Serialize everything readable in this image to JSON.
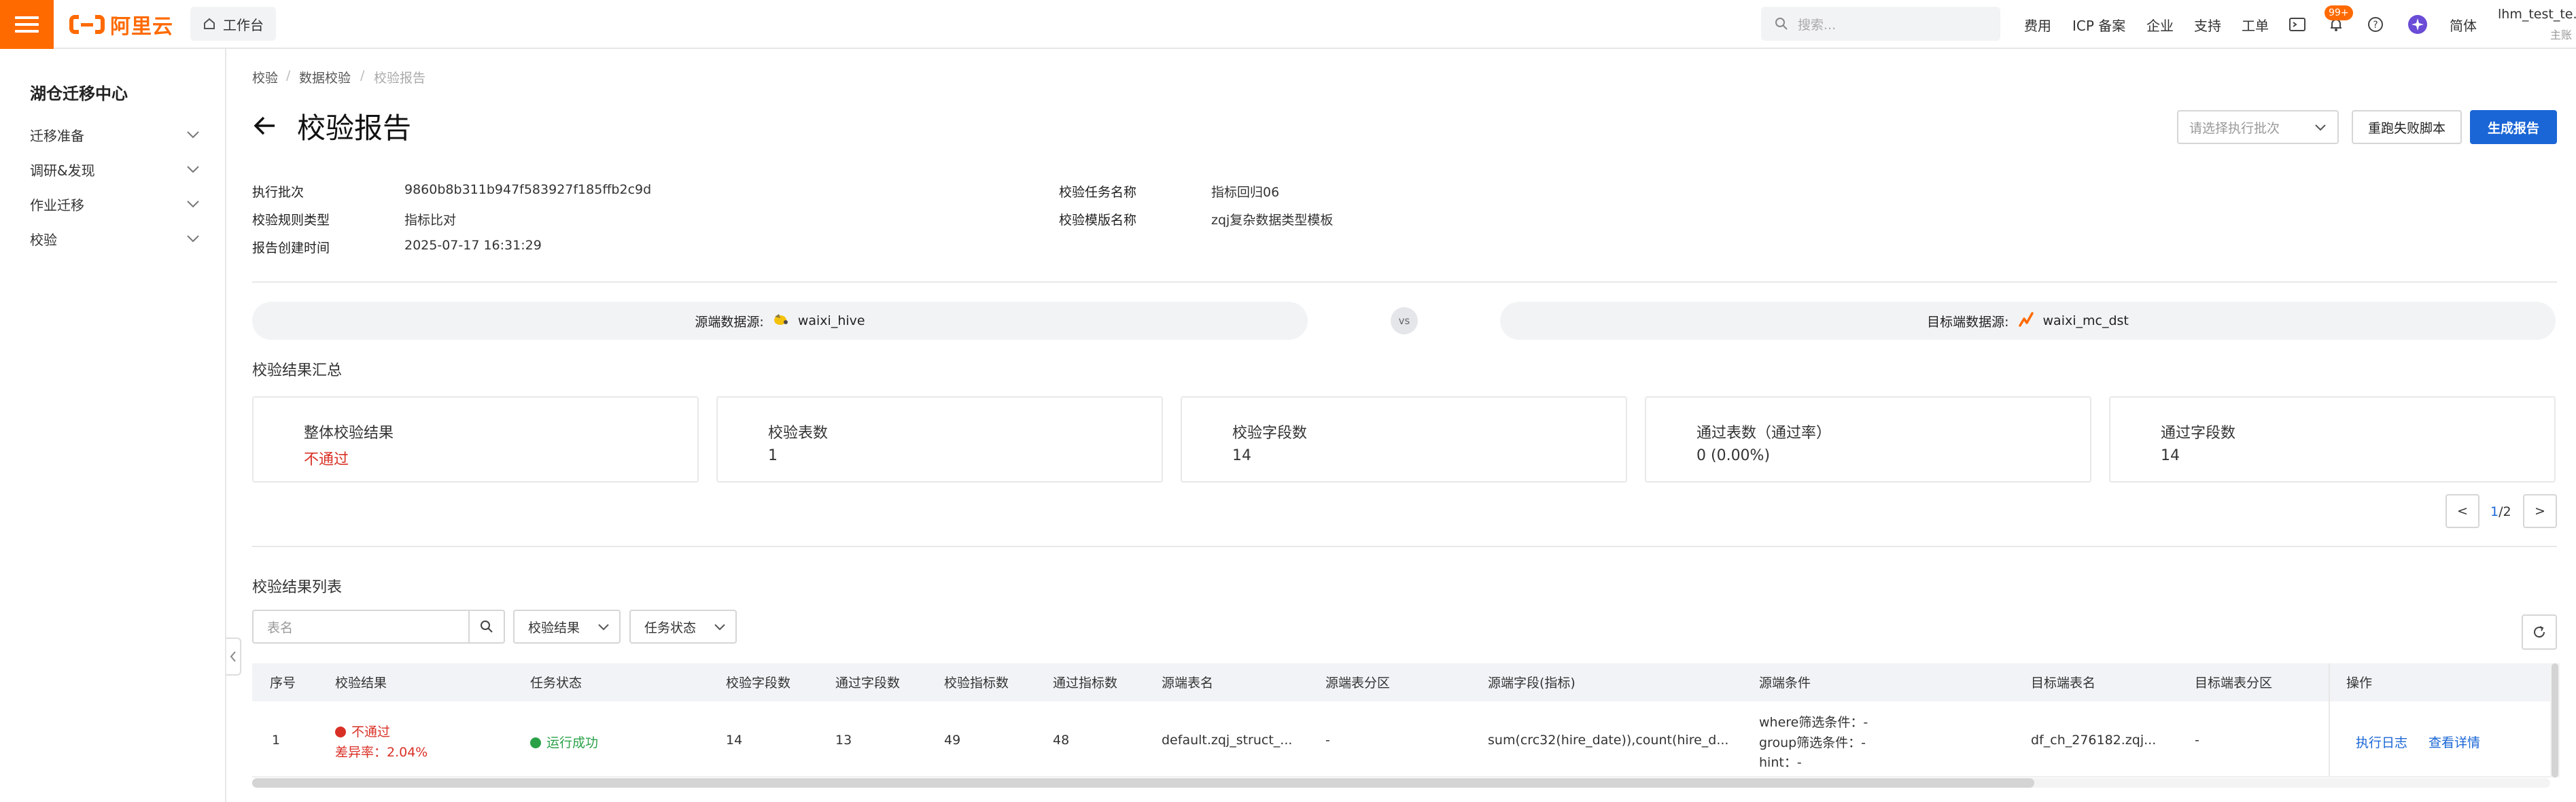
{
  "topbar": {
    "logo_text": "阿里云",
    "workspace": "工作台",
    "search_placeholder": "搜索...",
    "nav": [
      "费用",
      "ICP 备案",
      "企业",
      "支持",
      "工单"
    ],
    "notify_count": "99+",
    "lang": "简体",
    "user_name": "lhm_test_te...",
    "user_sub": "主账"
  },
  "sidebar": {
    "title": "湖仓迁移中心",
    "items": [
      "迁移准备",
      "调研&发现",
      "作业迁移",
      "校验"
    ]
  },
  "breadcrumb": [
    "校验",
    "数据校验",
    "校验报告"
  ],
  "page": {
    "title": "校验报告",
    "batch_placeholder": "请选择执行批次",
    "rerun_label": "重跑失败脚本",
    "generate_label": "生成报告"
  },
  "info": {
    "batch_key": "执行批次",
    "batch_val": "9860b8b311b947f583927f185ffb2c9d",
    "rule_key": "校验规则类型",
    "rule_val": "指标比对",
    "created_key": "报告创建时间",
    "created_val": "2025-07-17 16:31:29",
    "task_key": "校验任务名称",
    "task_val": "指标回归06",
    "tpl_key": "校验模版名称",
    "tpl_val": "zqj复杂数据类型模板"
  },
  "compare": {
    "source_label": "源端数据源:",
    "source_name": "waixi_hive",
    "vs": "vs",
    "target_label": "目标端数据源:",
    "target_name": "waixi_mc_dst"
  },
  "summary": {
    "title": "校验结果汇总",
    "cards": [
      {
        "label": "整体校验结果",
        "value": "不通过"
      },
      {
        "label": "校验表数",
        "value": "1"
      },
      {
        "label": "校验字段数",
        "value": "14"
      },
      {
        "label": "通过表数（通过率）",
        "value": "0 (0.00%)"
      },
      {
        "label": "通过字段数",
        "value": "14"
      }
    ],
    "pager_prev": "<",
    "pager_current": "1",
    "pager_total": "/2",
    "pager_next": ">"
  },
  "list": {
    "title": "校验结果列表",
    "search_placeholder": "表名",
    "filter_result": "校验结果",
    "filter_status": "任务状态",
    "columns": [
      "序号",
      "校验结果",
      "任务状态",
      "校验字段数",
      "通过字段数",
      "校验指标数",
      "通过指标数",
      "源端表名",
      "源端表分区",
      "源端字段(指标)",
      "源端条件",
      "目标端表名",
      "目标端表分区",
      "操作"
    ],
    "row": {
      "index": "1",
      "result": "不通过",
      "diff_rate": "差异率：2.04%",
      "status": "运行成功",
      "check_fields": "14",
      "pass_fields": "13",
      "check_metrics": "49",
      "pass_metrics": "48",
      "src_table": "default.zqj_struct_...",
      "src_partition": "-",
      "src_fields": "sum(crc32(hire_date)),count(hire_d...",
      "cond_where": "where筛选条件：-",
      "cond_group": "group筛选条件：-",
      "cond_hint": "hint：-",
      "dst_table": "df_ch_276182.zqj...",
      "dst_partition": "-",
      "op_log": "执行日志",
      "op_detail": "查看详情"
    }
  },
  "colors": {
    "brand": "#ff6a00",
    "primary": "#1a66d6",
    "fail": "#d93026",
    "success": "#2aa147"
  }
}
